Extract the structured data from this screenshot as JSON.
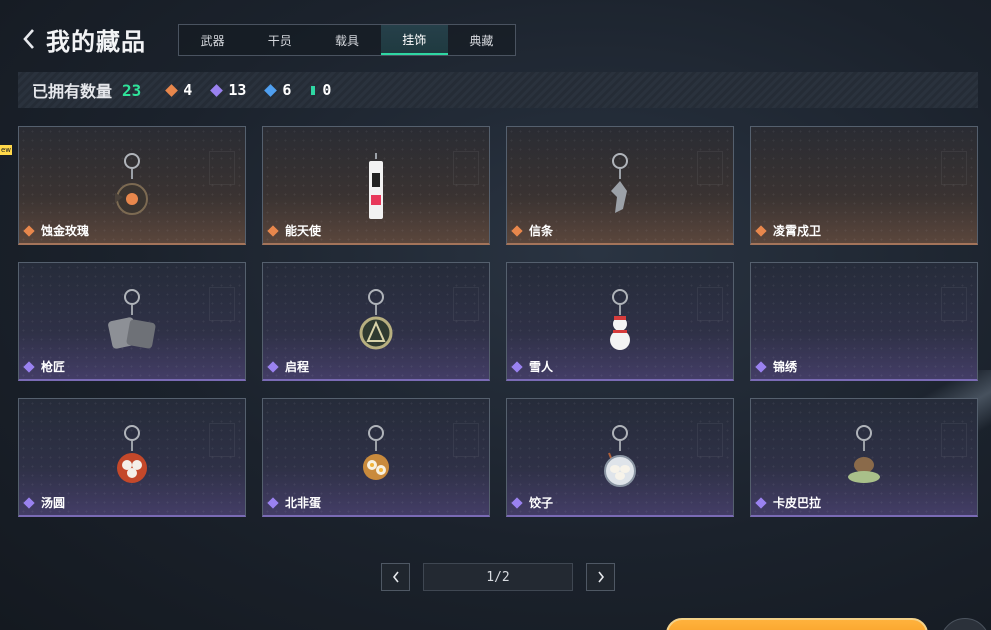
{
  "header": {
    "title": "我的藏品",
    "tabs": [
      {
        "label": "武器",
        "active": false
      },
      {
        "label": "干员",
        "active": false
      },
      {
        "label": "载具",
        "active": false
      },
      {
        "label": "挂饰",
        "active": true
      },
      {
        "label": "典藏",
        "active": false
      }
    ]
  },
  "stats": {
    "label": "已拥有数量",
    "total": "23",
    "rarities": [
      {
        "name": "orange",
        "color": "#e8874c",
        "count": "4"
      },
      {
        "name": "purple",
        "color": "#9a82f0",
        "count": "13"
      },
      {
        "name": "blue",
        "color": "#4f9ff0",
        "count": "6"
      },
      {
        "name": "green",
        "color": "#2fd7a3",
        "count": "0"
      }
    ]
  },
  "new_tag": "ew",
  "cards": [
    {
      "name": "蚀金玫瑰",
      "rarity": "orange",
      "icon": "rose-pendant-charm"
    },
    {
      "name": "能天使",
      "rarity": "orange",
      "icon": "energy-drink-can-charm"
    },
    {
      "name": "信条",
      "rarity": "orange",
      "icon": "eagle-charm"
    },
    {
      "name": "凌霄戍卫",
      "rarity": "orange",
      "icon": ""
    },
    {
      "name": "枪匠",
      "rarity": "purple",
      "icon": "dog-tags-charm"
    },
    {
      "name": "启程",
      "rarity": "purple",
      "icon": "medallion-charm"
    },
    {
      "name": "雪人",
      "rarity": "purple",
      "icon": "snowman-charm"
    },
    {
      "name": "锦绣",
      "rarity": "purple",
      "icon": ""
    },
    {
      "name": "汤圆",
      "rarity": "purple",
      "icon": "tangyuan-bowl-charm"
    },
    {
      "name": "北非蛋",
      "rarity": "purple",
      "icon": "shakshuka-charm"
    },
    {
      "name": "饺子",
      "rarity": "purple",
      "icon": "dumplings-plate-charm"
    },
    {
      "name": "卡皮巴拉",
      "rarity": "purple",
      "icon": "capybara-charm"
    }
  ],
  "pagination": {
    "current": "1/2"
  },
  "colors": {
    "accent": "#2fd7a3",
    "orange": "#e8874c",
    "purple": "#9a82f0"
  }
}
